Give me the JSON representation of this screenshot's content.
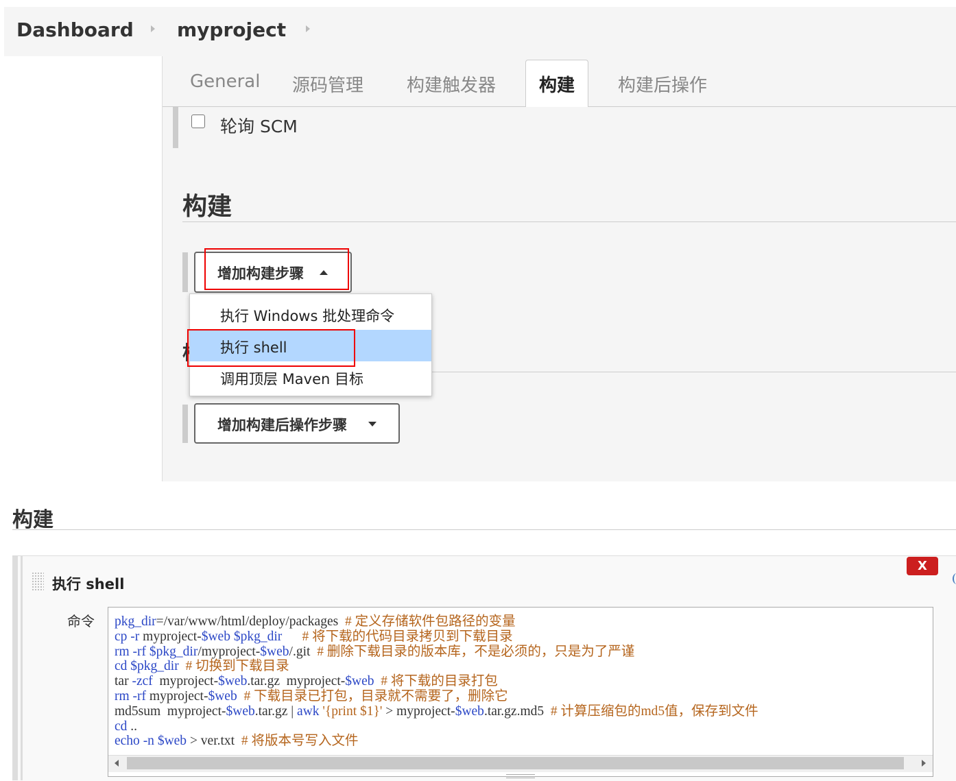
{
  "breadcrumb": {
    "items": [
      "Dashboard",
      "myproject"
    ]
  },
  "tabs": [
    "General",
    "源码管理",
    "构建触发器",
    "构建",
    "构建后操作"
  ],
  "active_tab": "构建",
  "trigger": {
    "poll_scm_label": "轮询 SCM",
    "poll_scm_checked": false
  },
  "build_section": {
    "heading": "构建",
    "partial_heading": "构"
  },
  "add_build_step": {
    "label": "增加构建步骤",
    "state": "open"
  },
  "build_step_menu": {
    "items": [
      "执行 Windows 批处理命令",
      "执行 shell",
      "调用顶层 Maven 目标"
    ],
    "highlighted": "执行 shell"
  },
  "add_post_build_step": {
    "label": "增加构建后操作步骤"
  },
  "step_panel": {
    "heading": "构建",
    "step_title": "执行 shell",
    "delete_label": "X",
    "command_label": "命令",
    "command_lines": [
      "pkg_dir=/var/www/html/deploy/packages  # 定义存储软件包路径的变量",
      "cp -r myproject-$web $pkg_dir      # 将下载的代码目录拷贝到下载目录",
      "rm -rf $pkg_dir/myproject-$web/.git  # 删除下载目录的版本库，不是必须的，只是为了严谨",
      "cd $pkg_dir  # 切换到下载目录",
      "tar -zcf  myproject-$web.tar.gz  myproject-$web  # 将下载的目录打包",
      "rm -rf myproject-$web  # 下载目录已打包，目录就不需要了，删除它",
      "md5sum  myproject-$web.tar.gz | awk '{print $1}' > myproject-$web.tar.gz.md5  # 计算压缩包的md5值，保存到文件",
      "cd ..",
      "echo -n $web > ver.txt  # 将版本号写入文件"
    ]
  },
  "colors": {
    "highlight": "#b3d7ff",
    "annotation_red": "#e00000",
    "delete_red": "#cc1f1f",
    "code_keyword": "#2b47c6",
    "code_comment": "#b5651d"
  }
}
